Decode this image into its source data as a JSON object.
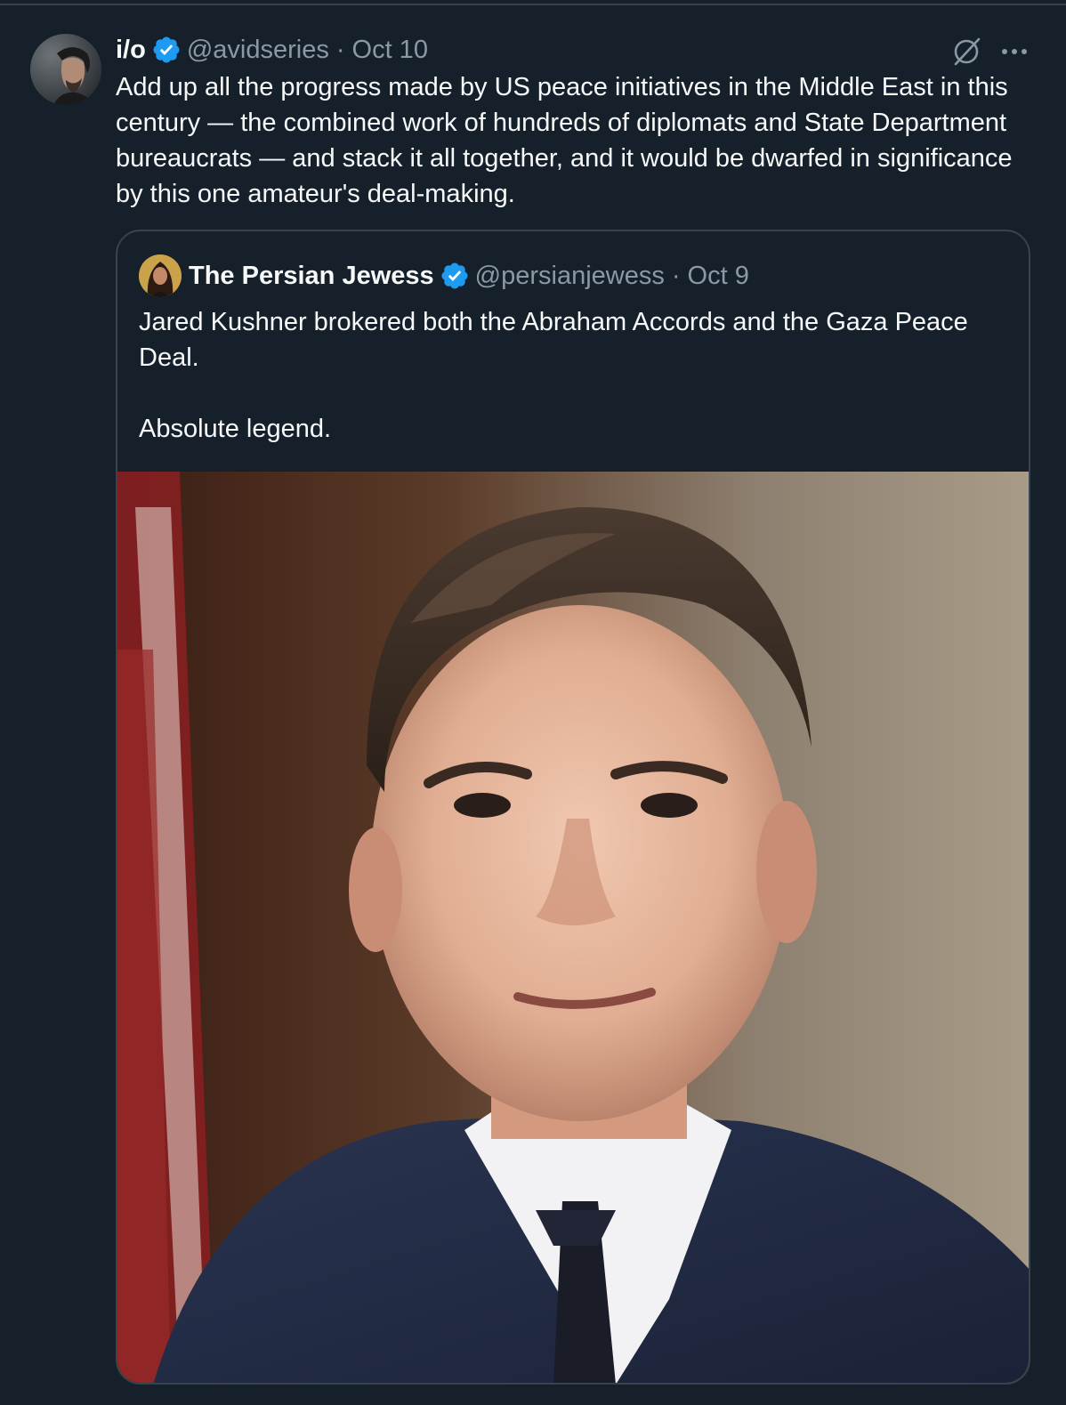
{
  "tweet": {
    "author": {
      "display_name": "i/o",
      "handle": "@avidseries",
      "verified": true
    },
    "separator": "·",
    "timestamp": "Oct 10",
    "text": "Add up all the progress made by US peace initiatives in the Middle East in this century — the combined work of hundreds of diplomats and State Department bureaucrats — and stack it all together, and it would be dwarfed in significance by this one amateur's deal-making.",
    "icons": {
      "grok": "grok-icon",
      "more": "more-icon"
    }
  },
  "quoted_tweet": {
    "author": {
      "display_name": "The Persian Jewess",
      "handle": "@persianjewess",
      "verified": true
    },
    "separator": "·",
    "timestamp": "Oct 9",
    "paragraphs": [
      "Jared Kushner brokered both the Abraham Accords and the Gaza Peace Deal.",
      "Absolute legend."
    ],
    "media": "portrait-photo"
  },
  "colors": {
    "background": "#15202b",
    "text": "#f7f9f9",
    "secondary_text": "#8b98a5",
    "border": "#38444d",
    "verified_badge": "#1d9bf0"
  }
}
